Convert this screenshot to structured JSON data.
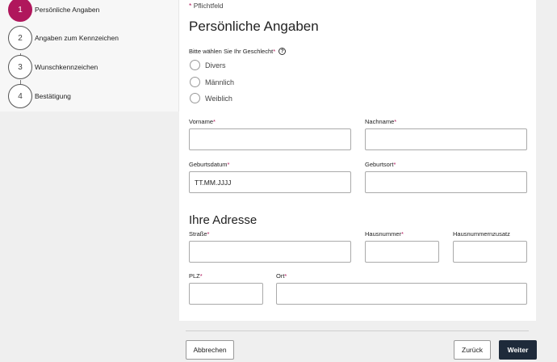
{
  "stepper": {
    "steps": [
      {
        "number": "1",
        "label": "Persönliche Angaben",
        "active": true
      },
      {
        "number": "2",
        "label": "Angaben zum Kennzeichen",
        "active": false
      },
      {
        "number": "3",
        "label": "Wunschkennzeichen",
        "active": false
      },
      {
        "number": "4",
        "label": "Bestätigung",
        "active": false
      }
    ]
  },
  "form": {
    "required_note": "Pflichtfeld",
    "required_star": "*",
    "title": "Persönliche Angaben",
    "gender": {
      "question": "Bitte wählen Sie Ihr Geschlecht",
      "help_icon_glyph": "?",
      "options": [
        "Divers",
        "Männlich",
        "Weiblich"
      ]
    },
    "fields": {
      "vorname": {
        "label": "Vorname",
        "value": ""
      },
      "nachname": {
        "label": "Nachname",
        "value": ""
      },
      "geburtsdatum": {
        "label": "Geburtsdatum",
        "placeholder": "TT.MM.JJJJ"
      },
      "geburtsort": {
        "label": "Geburtsort",
        "value": ""
      },
      "strasse": {
        "label": "Straße",
        "value": ""
      },
      "hausnummer": {
        "label": "Hausnummer",
        "value": ""
      },
      "hausnummernzusatz": {
        "label": "Hausnummernzusatz",
        "value": ""
      },
      "plz": {
        "label": "PLZ",
        "value": ""
      },
      "ort": {
        "label": "Ort",
        "value": ""
      }
    },
    "address_title": "Ihre Adresse"
  },
  "footer": {
    "cancel_label": "Abbrechen",
    "back_label": "Zurück",
    "next_label": "Weiter"
  },
  "colors": {
    "accent": "#b0175c",
    "primary_button": "#1e2a3a"
  }
}
